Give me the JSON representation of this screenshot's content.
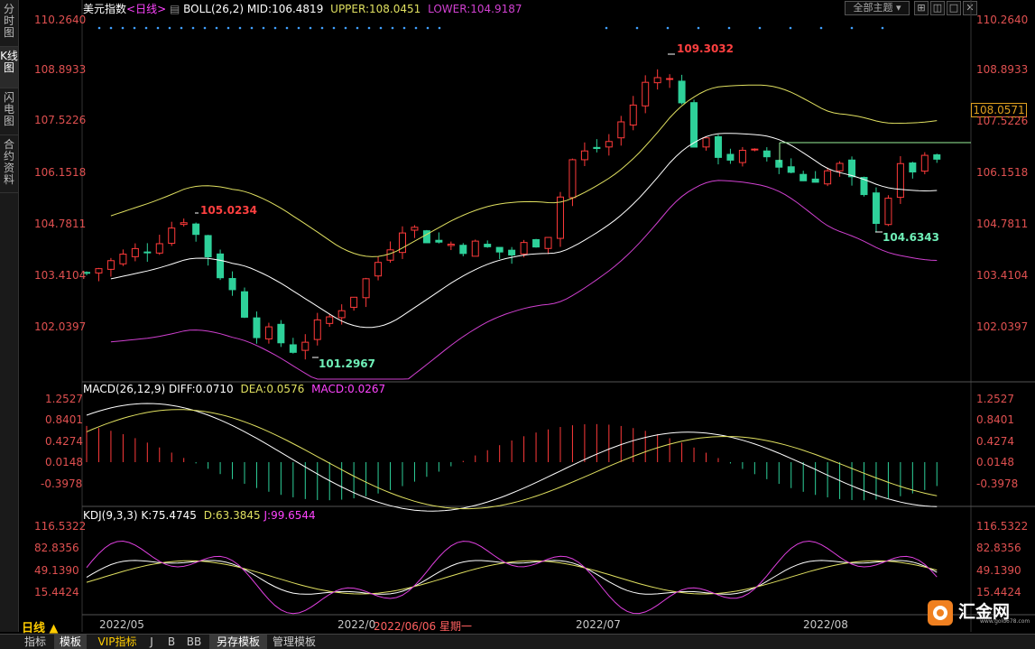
{
  "sidebar": {
    "items": [
      {
        "label": "分时图"
      },
      {
        "label": "K线图"
      },
      {
        "label": "闪电图"
      },
      {
        "label": "合约资料"
      }
    ]
  },
  "header": {
    "symbol": "美元指数",
    "period": "<日线>",
    "boll_label": "BOLL(26,2)",
    "mid": "MID:106.4819",
    "upper": "UPPER:108.0451",
    "lower": "LOWER:104.9187",
    "theme_select": "全部主题",
    "price_tag": "108.0571"
  },
  "main_axis": {
    "labels": [
      "110.2640",
      "108.8933",
      "107.5226",
      "106.1518",
      "104.7811",
      "103.4104",
      "102.0397"
    ]
  },
  "annotations": {
    "high1": "105.0234",
    "high2": "109.3032",
    "low1": "101.2967",
    "low2": "104.6343"
  },
  "macd": {
    "label": "MACD(26,12,9)",
    "diff": "DIFF:0.0710",
    "dea": "DEA:0.0576",
    "macd": "MACD:0.0267",
    "axis": [
      "1.2527",
      "0.8401",
      "0.4274",
      "0.0148",
      "-0.3978"
    ]
  },
  "kdj": {
    "label": "KDJ(9,3,3)",
    "k": "K:75.4745",
    "d": "D:63.3845",
    "j": "J:99.6544",
    "axis": [
      "116.5322",
      "82.8356",
      "49.1390",
      "15.4424"
    ]
  },
  "xaxis": {
    "period_button": "日线 ▲",
    "labels": [
      "2022/05",
      "2022/0",
      "2022/07",
      "2022/08"
    ],
    "cursor_date": "2022/06/06 星期一"
  },
  "bottom_tabs": [
    "指标",
    "模板",
    "VIP指标",
    "J",
    "B",
    "BB",
    "另存模板",
    "管理模板"
  ],
  "logo": {
    "text": "汇金网",
    "url_text": "www.gold678.com"
  },
  "colors": {
    "up": "#ff3a3a",
    "down": "#2ed19a",
    "upper": "#e0e060",
    "mid": "#ffffff",
    "lower": "#d040d0"
  }
}
